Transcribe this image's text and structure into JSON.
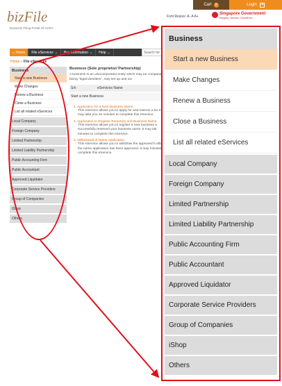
{
  "header": {
    "cart_label": "Cart",
    "cart_count": "0",
    "login_label": "Login",
    "logo_text": "bizFile",
    "logo_subtitle": "Business Filing Portal Of ACRA",
    "font_resize": "Font Resize:  A-  A  A+",
    "gov_title": "Singapore Government",
    "gov_subtitle": "Integrity • Service • Excellence"
  },
  "nav": {
    "items": [
      "Home",
      "File eServices",
      "Buy Information",
      "Help"
    ],
    "search_placeholder": "Search for"
  },
  "breadcrumb": {
    "home": "Home",
    "sep": " » ",
    "current": "File eServices"
  },
  "sidebar": {
    "heading": "Business",
    "subitems": [
      "Start a new Business",
      "Make Changes",
      "Renew a Business",
      "Close a Business",
      "List all related eServices"
    ],
    "items": [
      "Local Company",
      "Foreign Company",
      "Limited Partnership",
      "Limited Liability Partnership",
      "Public Accounting Firm",
      "Public Accountant",
      "Approved Liquidator",
      "Corporate Service Providers",
      "Group of Companies",
      "iShop",
      "Others"
    ]
  },
  "content": {
    "title": "Business (Sole proprietor/ Partnership)",
    "intro": "A business is an unincorporated entity which may be companies, being \"legal identities\", may set up and ow",
    "col_sn": "S/n",
    "col_name": "eServices Name",
    "row_label": "Start a new Business",
    "list": [
      {
        "title": "1.  Application for a New Business Name",
        "desc": "This eService allows you to apply for and reserve a bu It may take you 15 minutes to complete this eService."
      },
      {
        "title": "2.  Application to Register Person(s) and Business Name",
        "desc": "This eService allows you to register a new business a successfully reserved your business name. It may tak minutes to complete this eService."
      },
      {
        "title": "3.  Withdrawal of Name Application",
        "desc": "This eService allows you to withdraw the approved b after the name application has been approved. It may minutes to complete this eService."
      }
    ]
  },
  "colors": {
    "accent": "#f08c1e",
    "annotation": "#e0101a",
    "active_row": "#fbd8b6",
    "nav_bg": "#3a3a3a"
  }
}
